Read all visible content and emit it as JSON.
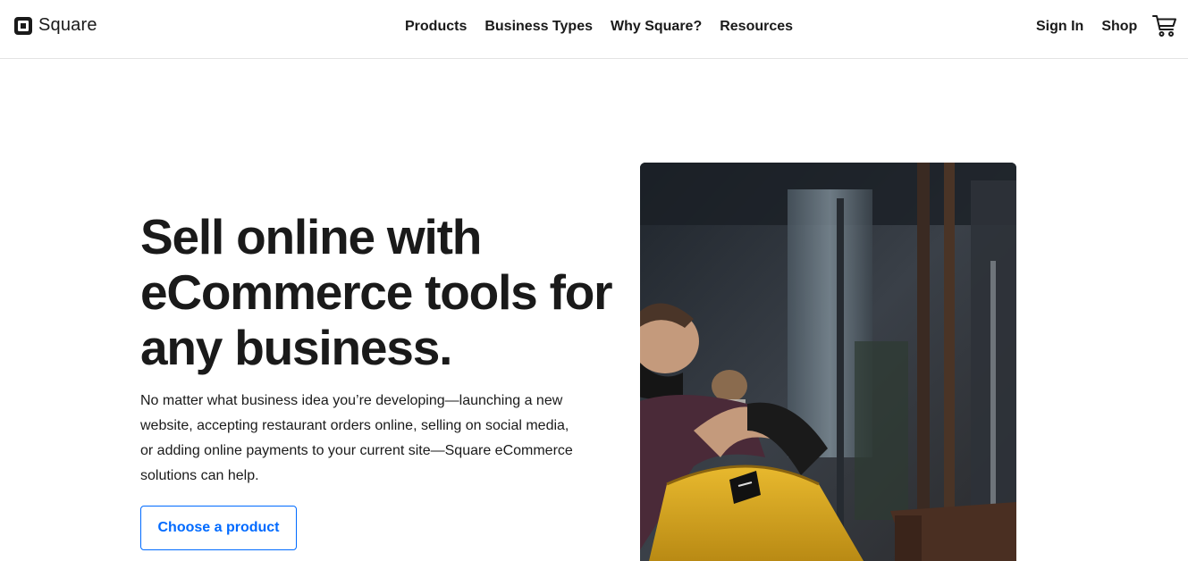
{
  "header": {
    "logo_text": "Square",
    "nav": [
      "Products",
      "Business Types",
      "Why Square?",
      "Resources"
    ],
    "sign_in": "Sign In",
    "shop": "Shop"
  },
  "hero": {
    "title": "Sell online with eCommerce tools for any business.",
    "description": "No matter what business idea you’re developing—launching a new website, accepting restaurant orders online, selling on social media, or adding online payments to your current site—Square eCommerce solutions can help.",
    "cta_label": "Choose a product"
  },
  "icons": {
    "logo": "square-logo-icon",
    "cart": "shopping-cart-icon"
  },
  "colors": {
    "accent": "#006aff",
    "text": "#1a1a1a",
    "divider": "#e3e3e3",
    "bag_yellow": "#e0b028"
  }
}
